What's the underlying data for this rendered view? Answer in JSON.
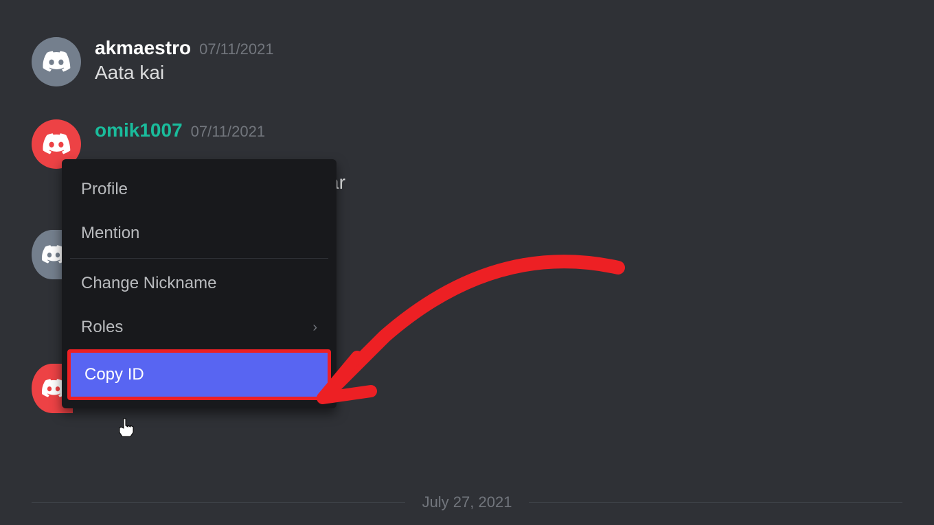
{
  "messages": [
    {
      "username": "akmaestro",
      "timestamp": "07/11/2021",
      "text": "Aata kai",
      "avatar_color": "grey"
    },
    {
      "username": "omik1007",
      "timestamp": "07/11/2021",
      "text": "ar",
      "avatar_color": "red"
    }
  ],
  "context_menu": {
    "items": [
      {
        "label": "Profile"
      },
      {
        "label": "Mention"
      },
      {
        "label": "Change Nickname"
      },
      {
        "label": "Roles",
        "has_submenu": true
      },
      {
        "label": "Copy ID",
        "highlighted": true
      }
    ]
  },
  "date_divider": "July 27, 2021",
  "colors": {
    "background": "#2f3136",
    "menu_bg": "#18191c",
    "highlight": "#5865f2",
    "annotation_red": "#ed2024",
    "teal": "#1abc9c"
  }
}
